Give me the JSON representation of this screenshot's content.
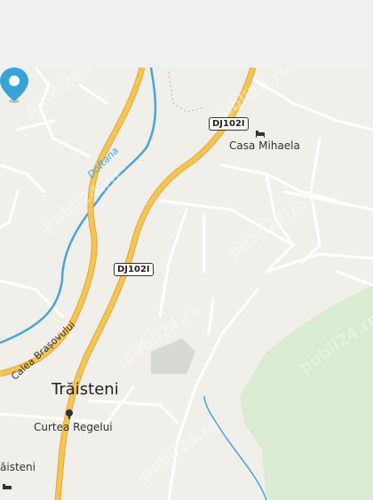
{
  "map": {
    "places": {
      "main_town": "Trăisteni",
      "poi_guesthouse": "Casa Mihaela",
      "poi_landmark": "Curtea Regelui",
      "partial_town": "ăisteni"
    },
    "roads": {
      "shield_north": "DJ102I",
      "shield_mid": "DJ102I",
      "street_main": "Calea Brașovului"
    },
    "waterway": "Doftana",
    "watermark_text": "publi24.ro",
    "colors": {
      "background": "#f1efe9",
      "major_road": "#f6c453",
      "major_road_casing": "#e0a93a",
      "minor_road": "#ffffff",
      "river": "#4aa3df",
      "forest": "#d9ebd0",
      "building": "#d9d9d4",
      "pin": "#36a3d9"
    },
    "icons": {
      "guesthouse": "bed-icon",
      "landmark": "tree-icon",
      "pin": "map-pin-icon"
    }
  }
}
